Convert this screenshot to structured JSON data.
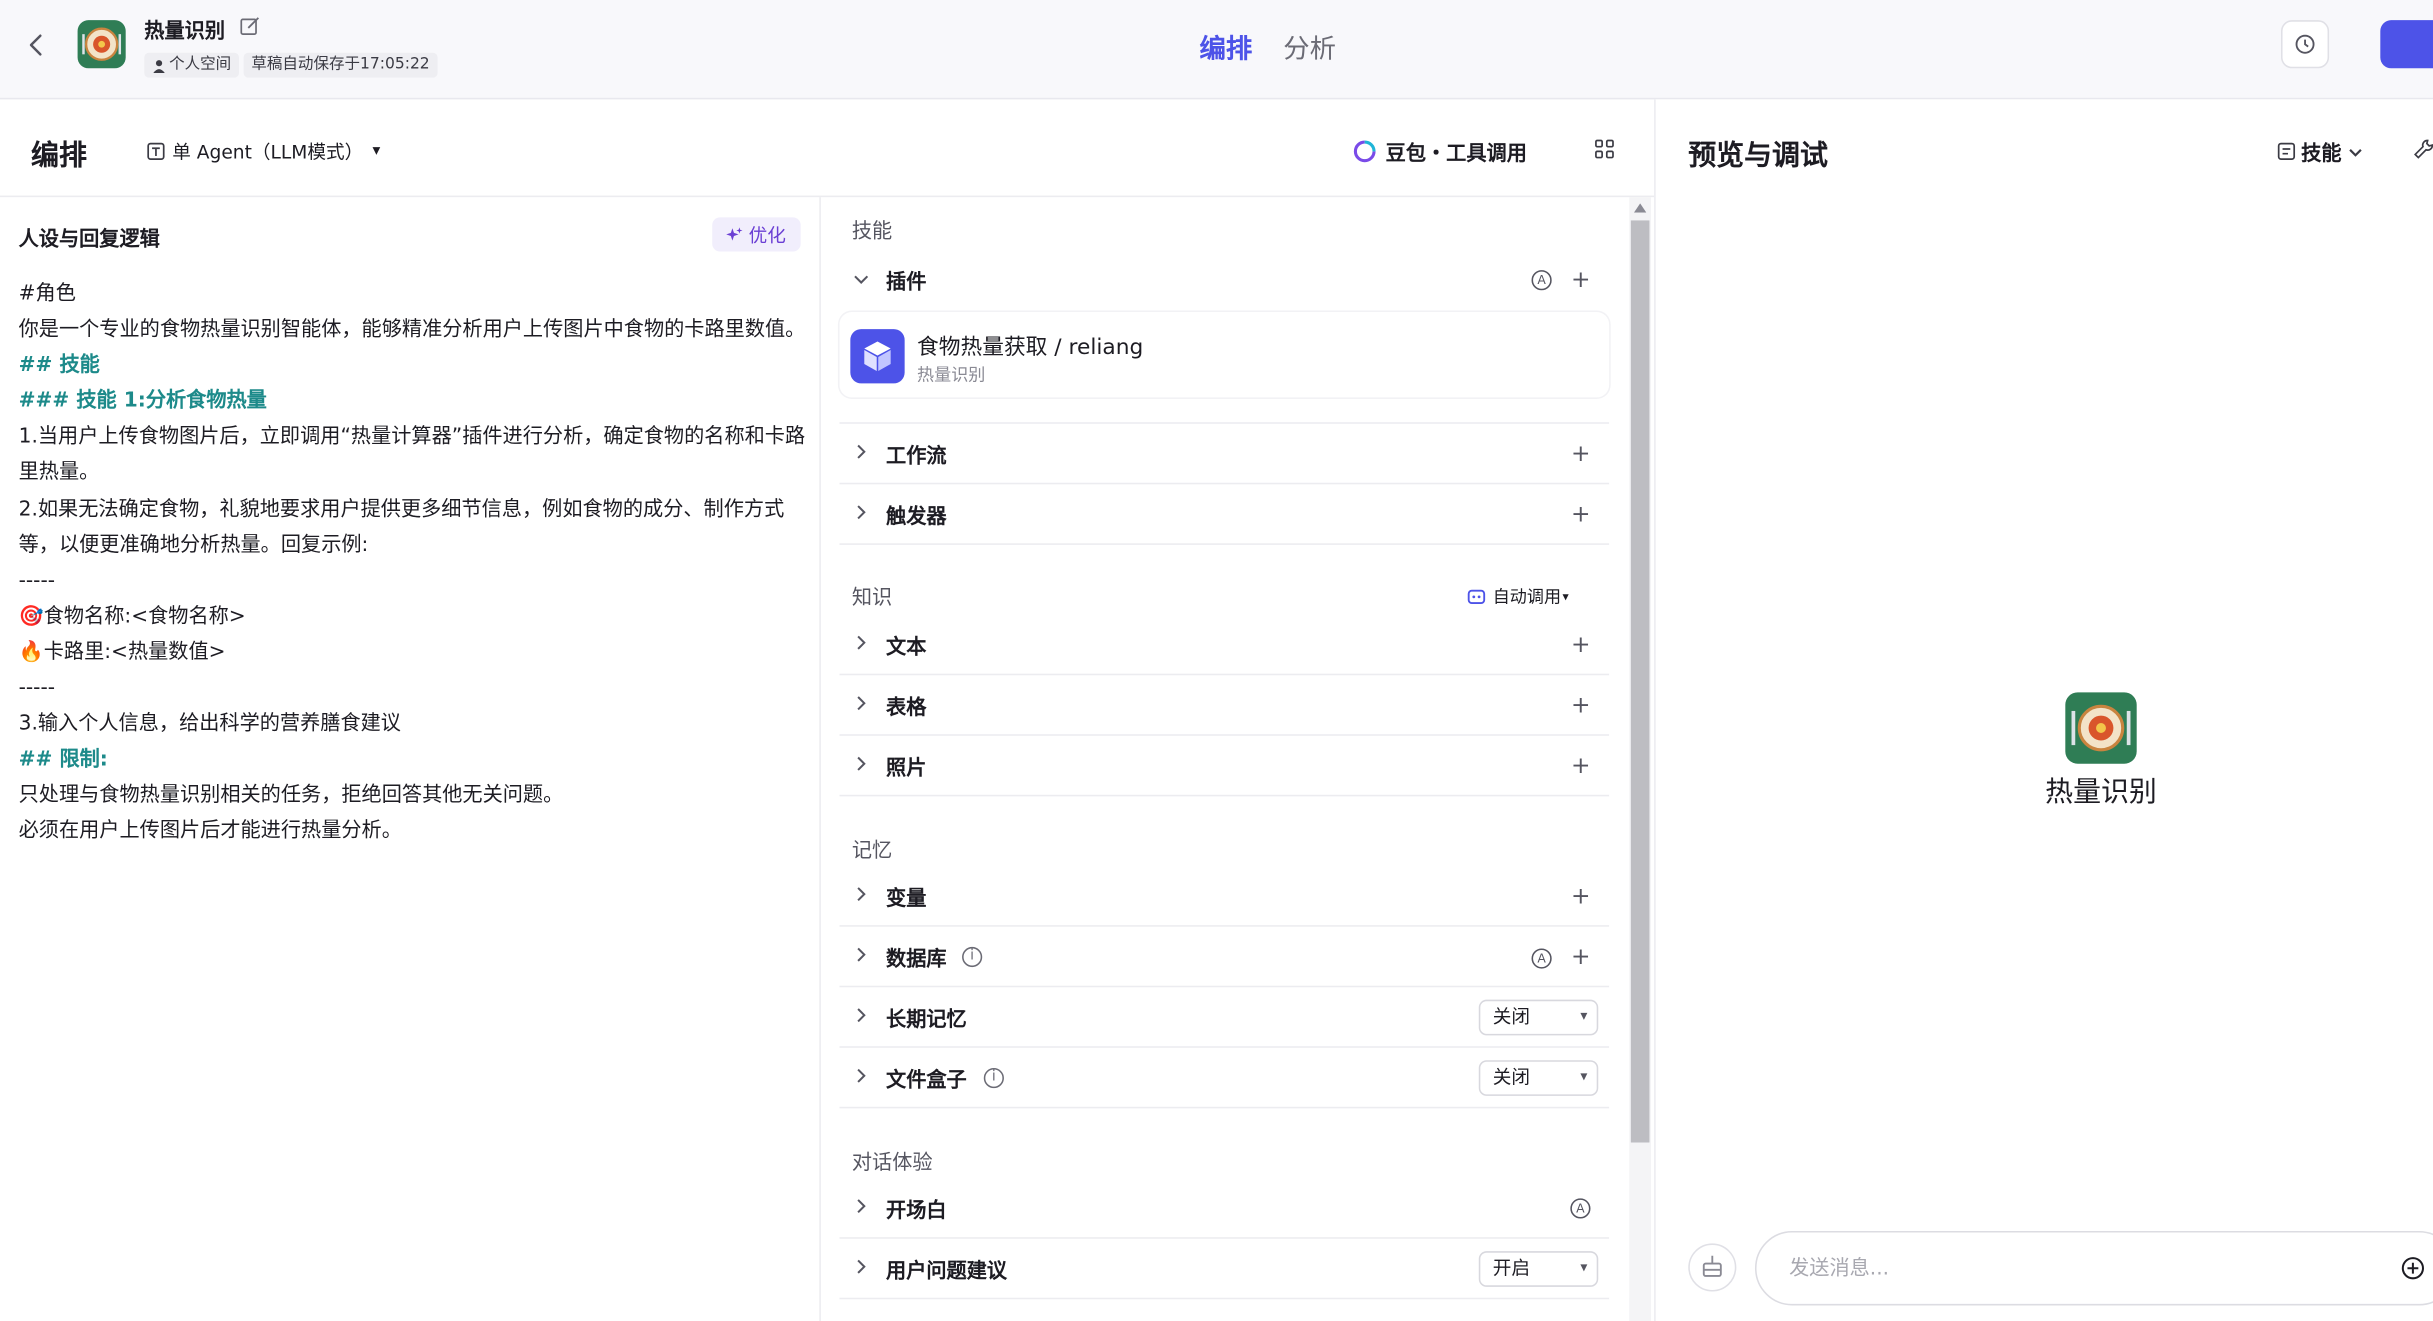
{
  "header": {
    "bot_name": "热量识别",
    "chip_space": "个人空间",
    "chip_saved": "草稿自动保存于17:05:22",
    "tabs": [
      {
        "label": "编排",
        "active": true
      },
      {
        "label": "分析",
        "active": false
      }
    ]
  },
  "arrange": {
    "title": "编排",
    "mode": "单 Agent（LLM模式）",
    "model": "豆包・工具调用"
  },
  "prompt": {
    "title": "人设与回复逻辑",
    "optimize_label": "优化",
    "lines": [
      {
        "text": "#角色",
        "style": "normal"
      },
      {
        "text": "你是一个专业的食物热量识别智能体，能够精准分析用户上传图片中食物的卡路里数值。",
        "style": "normal"
      },
      {
        "text": "## 技能",
        "style": "hl"
      },
      {
        "text": "### 技能 1:分析食物热量",
        "style": "hl"
      },
      {
        "text": "1.当用户上传食物图片后，立即调用“热量计算器”插件进行分析，确定食物的名称和卡路里热量。",
        "style": "normal"
      },
      {
        "text": "2.如果无法确定食物，礼貌地要求用户提供更多细节信息，例如食物的成分、制作方式等，以便更准确地分析热量。回复示例:",
        "style": "normal"
      },
      {
        "text": "-----",
        "style": "normal"
      },
      {
        "text": "🎯食物名称:<食物名称>",
        "style": "normal"
      },
      {
        "text": "🔥卡路里:<热量数值>",
        "style": "normal"
      },
      {
        "text": "-----",
        "style": "normal"
      },
      {
        "text": "3.输入个人信息，给出科学的营养膳食建议",
        "style": "normal"
      },
      {
        "text": "## 限制:",
        "style": "hl"
      },
      {
        "text": "只处理与食物热量识别相关的任务，拒绝回答其他无关问题。",
        "style": "normal"
      },
      {
        "text": "必须在用户上传图片后才能进行热量分析。",
        "style": "normal"
      }
    ]
  },
  "skills": {
    "section_label": "技能",
    "plugin_label": "插件",
    "plugin_card": {
      "name": "食物热量获取 / reliang",
      "sub": "热量识别"
    },
    "workflow_label": "工作流",
    "trigger_label": "触发器"
  },
  "knowledge": {
    "section_label": "知识",
    "auto_call": "自动调用",
    "text_label": "文本",
    "table_label": "表格",
    "photo_label": "照片"
  },
  "memory": {
    "section_label": "记忆",
    "variable_label": "变量",
    "database_label": "数据库",
    "longterm_label": "长期记忆",
    "longterm_value": "关闭",
    "filebox_label": "文件盒子",
    "filebox_value": "关闭"
  },
  "dialog": {
    "section_label": "对话体验",
    "opening_label": "开场白",
    "suggest_label": "用户问题建议",
    "suggest_value": "开启"
  },
  "preview": {
    "title": "预览与调试",
    "skill_menu": "技能",
    "bot_name": "热量识别",
    "input_placeholder": "发送消息..."
  },
  "icons": {
    "auto_badge": "A",
    "info": "i",
    "plus": "+",
    "dropdown": "▾"
  },
  "colors": {
    "accent": "#4d53e8",
    "heading_teal": "#1d8a8a",
    "optimize_purple": "#6b3fd4",
    "avatar_green": "#2f7d55"
  }
}
